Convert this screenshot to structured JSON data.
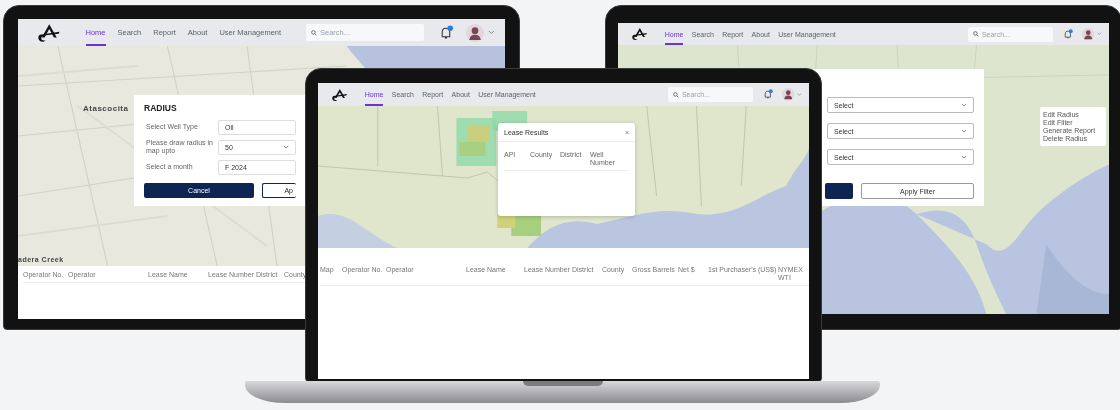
{
  "left_screen": {
    "nav": {
      "items": [
        {
          "label": "Home",
          "selected": true
        },
        {
          "label": "Search",
          "selected": false
        },
        {
          "label": "Report",
          "selected": false
        },
        {
          "label": "About",
          "selected": false
        },
        {
          "label": "User Management",
          "selected": false
        }
      ],
      "search_placeholder": "Search..."
    },
    "map_labels": [
      "Atascocita",
      "adera Creek"
    ],
    "radius_dialog": {
      "title": "RADIUS",
      "fields": [
        {
          "label": "Select Well Type",
          "value": "Oil",
          "kind": "text"
        },
        {
          "label": "Please draw radius in map upto",
          "value": "50",
          "kind": "select"
        },
        {
          "label": "Select a month",
          "value": "F 2024",
          "kind": "text"
        }
      ],
      "buttons": [
        {
          "label": "Cancel",
          "kind": "primary"
        },
        {
          "label": "Ap",
          "kind": "outline"
        }
      ]
    },
    "table": {
      "columns": [
        "Operator No.",
        "Operator",
        "Lease Name",
        "Lease Number",
        "District",
        "County"
      ]
    }
  },
  "center_screen": {
    "nav": {
      "items": [
        {
          "label": "Home",
          "selected": true
        },
        {
          "label": "Search",
          "selected": false
        },
        {
          "label": "Report",
          "selected": false
        },
        {
          "label": "About",
          "selected": false
        },
        {
          "label": "User Management",
          "selected": false
        }
      ],
      "search_placeholder": "Search..."
    },
    "lease_results": {
      "title": "Lease Results",
      "close": "×",
      "columns": [
        "API",
        "County",
        "District",
        "Well Number"
      ]
    },
    "table": {
      "columns": [
        "Map",
        "Operator No.",
        "Operator",
        "Lease Name",
        "Lease Number",
        "District",
        "County",
        "Gross Barrels",
        "Net $",
        "1st Purchaser's (US$)",
        "NYMEX WTI"
      ]
    }
  },
  "right_screen": {
    "nav": {
      "items": [
        {
          "label": "Home",
          "selected": true
        },
        {
          "label": "Search",
          "selected": false
        },
        {
          "label": "Report",
          "selected": false
        },
        {
          "label": "About",
          "selected": false
        },
        {
          "label": "User Management",
          "selected": false
        }
      ],
      "search_placeholder": "Search..."
    },
    "filter_dialog": {
      "selects": [
        "Select",
        "Select",
        "Select"
      ],
      "apply_button": "Apply Filter"
    },
    "context_menu": [
      "Edit Radius",
      "Edit Filter",
      "Generate Report",
      "Delete Radius"
    ]
  }
}
